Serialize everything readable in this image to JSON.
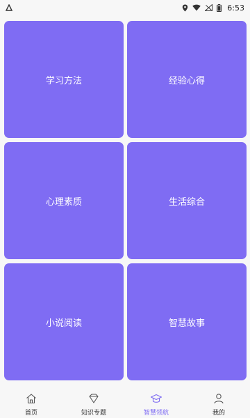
{
  "status_bar": {
    "time": "6:53",
    "icons": [
      "app-notification-icon",
      "location-icon",
      "wifi-icon",
      "signal-icon",
      "battery-icon"
    ]
  },
  "tiles": [
    {
      "label": "学习方法"
    },
    {
      "label": "经验心得"
    },
    {
      "label": "心理素质"
    },
    {
      "label": "生活综合"
    },
    {
      "label": "小说阅读"
    },
    {
      "label": "智慧故事"
    }
  ],
  "nav": [
    {
      "label": "首页",
      "icon": "home-icon",
      "active": false
    },
    {
      "label": "知识专题",
      "icon": "diamond-icon",
      "active": false
    },
    {
      "label": "智慧领航",
      "icon": "graduation-cap-icon",
      "active": true
    },
    {
      "label": "我的",
      "icon": "user-icon",
      "active": false
    }
  ],
  "colors": {
    "tile": "#7f6cf3",
    "accent": "#7f6cf3",
    "background": "#f7f7f7"
  }
}
